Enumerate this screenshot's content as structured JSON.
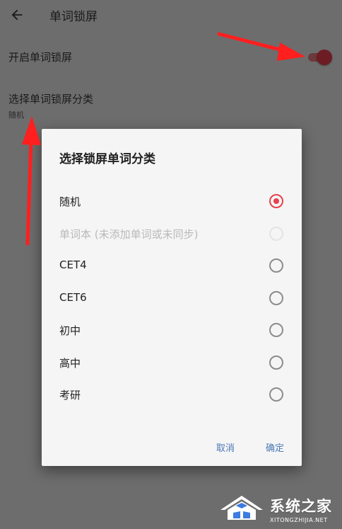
{
  "appbar": {
    "back_icon": "arrow-left-icon",
    "title": "单词锁屏"
  },
  "settings": {
    "enable_label": "开启单词锁屏",
    "enable_on": true,
    "category_label": "选择单词锁屏分类",
    "category_value": "随机"
  },
  "dialog": {
    "title": "选择锁屏单词分类",
    "options": [
      {
        "label": "随机",
        "selected": true,
        "enabled": true
      },
      {
        "label": "单词本 (未添加单词或未同步)",
        "selected": false,
        "enabled": false
      },
      {
        "label": "CET4",
        "selected": false,
        "enabled": true
      },
      {
        "label": "CET6",
        "selected": false,
        "enabled": true
      },
      {
        "label": "初中",
        "selected": false,
        "enabled": true
      },
      {
        "label": "高中",
        "selected": false,
        "enabled": true
      },
      {
        "label": "考研",
        "selected": false,
        "enabled": true
      }
    ],
    "cancel_label": "取消",
    "confirm_label": "确定"
  },
  "watermark": {
    "name": "系统之家",
    "url": "XITONGZHIJIA.NET"
  },
  "colors": {
    "accent": "#e8404b",
    "dialog_button": "#4a79b5",
    "annotation": "#ff1f1f",
    "scrim": "#6d6d6d"
  }
}
